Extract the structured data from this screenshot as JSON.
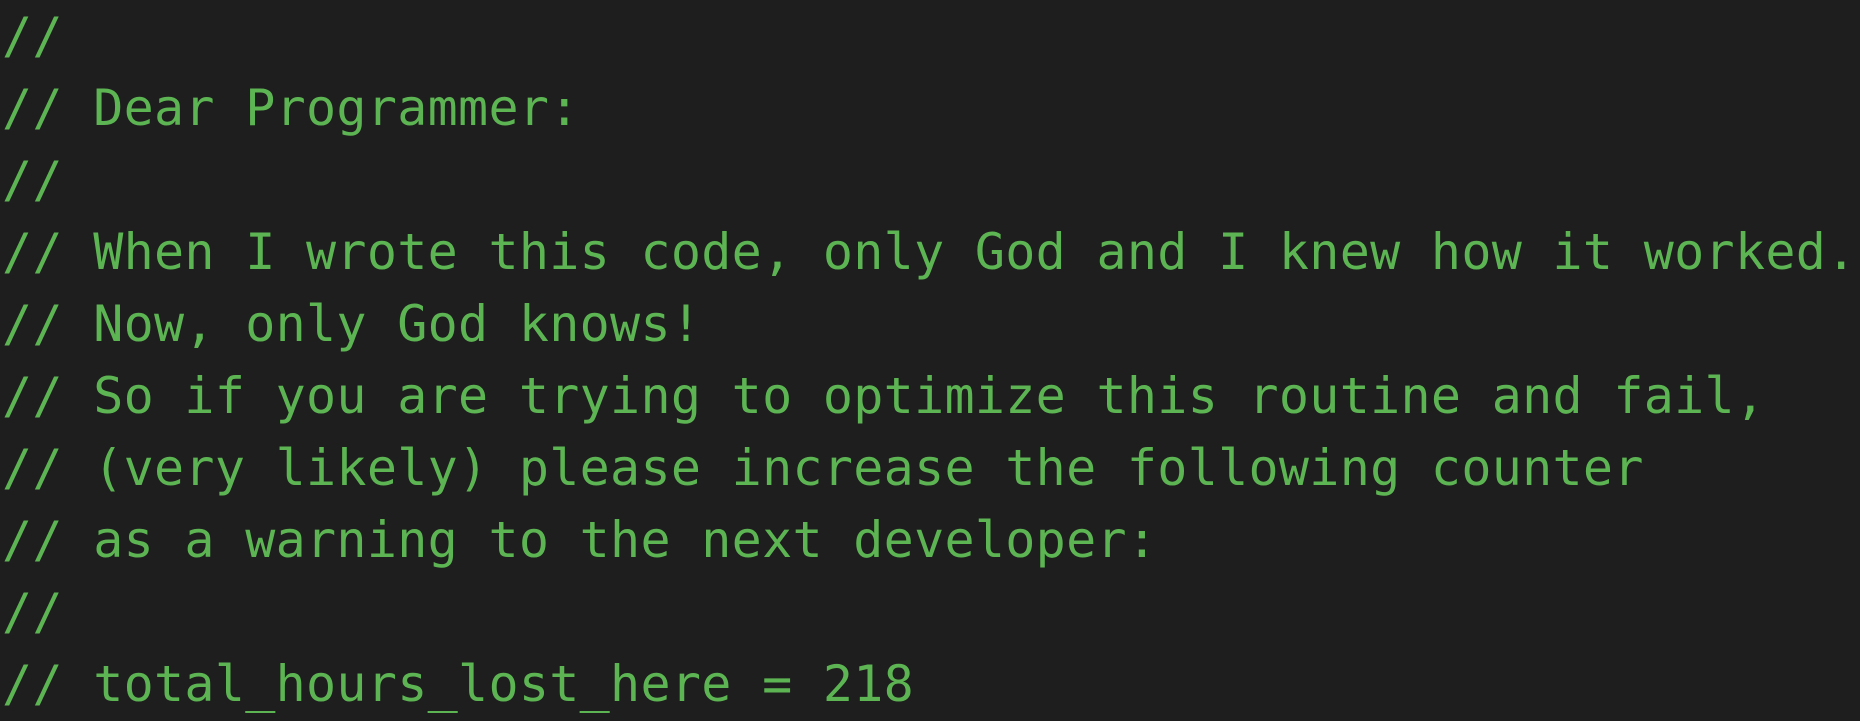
{
  "editor": {
    "text_color": "#5cb552",
    "background": "#1e1e1e",
    "lines": [
      "//",
      "// Dear Programmer:",
      "//",
      "// When I wrote this code, only God and I knew how it worked.",
      "// Now, only God knows!",
      "// So if you are trying to optimize this routine and fail,",
      "// (very likely) please increase the following counter",
      "// as a warning to the next developer:",
      "//",
      "// total_hours_lost_here = 218"
    ]
  }
}
